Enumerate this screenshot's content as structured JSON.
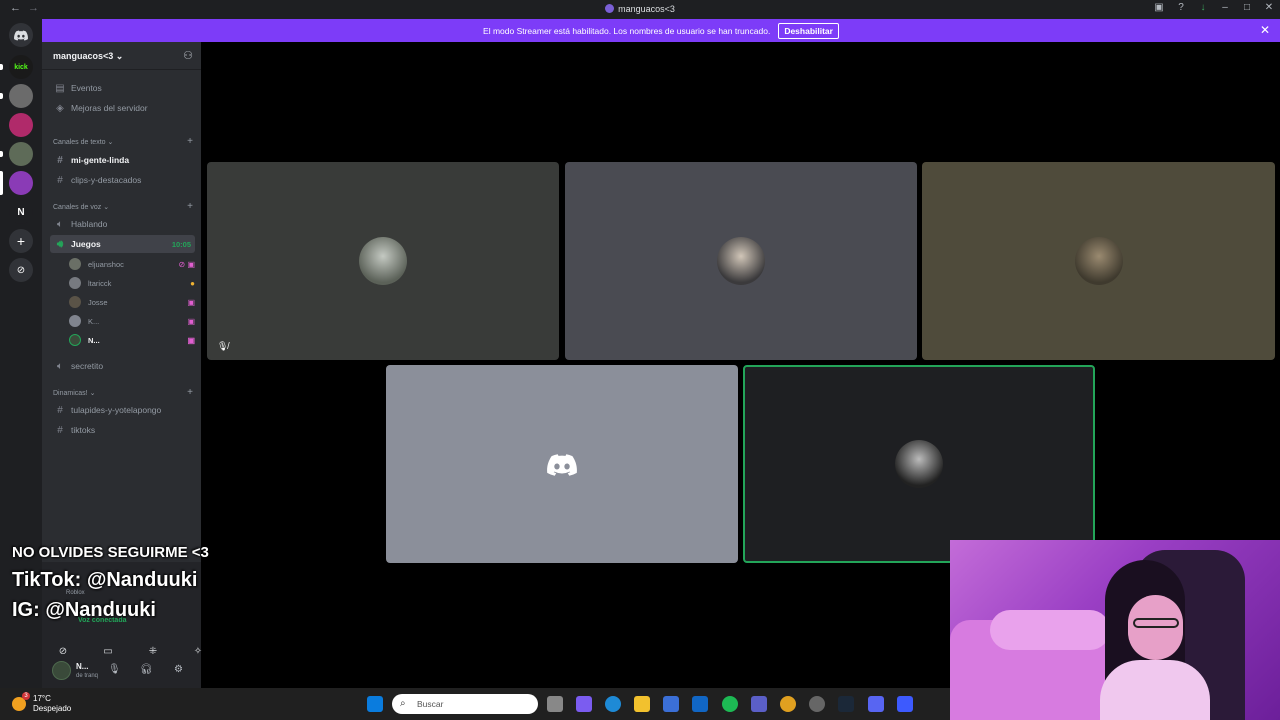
{
  "titlebar": {
    "title": "manguacos<3"
  },
  "banner": {
    "text": "El modo Streamer está habilitado. Los nombres de usuario se han truncado.",
    "button": "Deshabilitar"
  },
  "server_list": {
    "home_letter": "N"
  },
  "guild": {
    "name": "manguacos<3 ⌄"
  },
  "nav": {
    "events": "Eventos",
    "boosts": "Mejoras del servidor"
  },
  "categories": {
    "text": "Canales de texto ⌄",
    "voice": "Canales de voz ⌄",
    "dynamic": "Dinamicas! ⌄"
  },
  "text_channels": [
    "mi-gente-linda",
    "clips-y-destacados"
  ],
  "voice_channels": {
    "talking": "Hablando",
    "games": "Juegos",
    "games_time": "10:05",
    "secret": "secretito"
  },
  "members": [
    "eljuanshoc",
    "ltaricck",
    "Josse",
    "K...",
    "N..."
  ],
  "dynamic_channels": [
    "tulapides-y-yotelapongo",
    "tiktoks"
  ],
  "panel": {
    "activity": "Roblox",
    "voice_connected": "Voz conectada"
  },
  "user": {
    "name": "N...",
    "status": "de tranq"
  },
  "overlay": {
    "line1": "NO OLVIDES SEGUIRME <3",
    "line2": "TikTok: @Nanduuki",
    "line3": "IG: @Nanduuki"
  },
  "taskbar": {
    "temp": "17°C",
    "condition": "Despejado",
    "search_placeholder": "Buscar",
    "weather_badge": "3"
  },
  "colors": {
    "blurple": "#5865f2",
    "streamer_banner": "#7d3cf8",
    "speaking_green": "#23a559"
  }
}
